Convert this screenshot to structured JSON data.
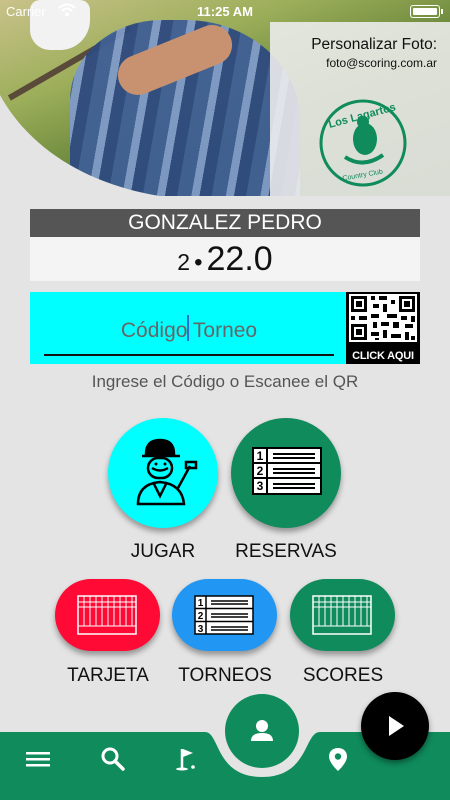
{
  "status_bar": {
    "carrier": "Carrier",
    "time": "11:25 AM"
  },
  "photo_panel": {
    "title": "Personalizar Foto:",
    "email": "foto@scoring.com.ar",
    "logo_text": "Los Lagartos",
    "logo_subtext": "Country Club"
  },
  "player": {
    "name": "GONZALEZ PEDRO",
    "handicap_index": "2",
    "handicap_value": "22.0"
  },
  "code": {
    "placeholder": "Código Torneo",
    "qr_label": "CLICK AQUI",
    "hint": "Ingrese el Código o Escanee el QR"
  },
  "actions": {
    "jugar": "JUGAR",
    "reservas": "RESERVAS",
    "tarjeta": "TARJETA",
    "torneos": "TORNEOS",
    "scores": "SCORES"
  },
  "colors": {
    "cyan": "#00ffff",
    "green": "#0f8b5c",
    "red": "#ff0a35",
    "blue": "#2196f3",
    "namebar": "#555555"
  },
  "nav": {
    "icons": [
      "menu-icon",
      "search-icon",
      "golf-flag-icon",
      "profile-icon",
      "location-icon",
      "play-icon"
    ]
  }
}
